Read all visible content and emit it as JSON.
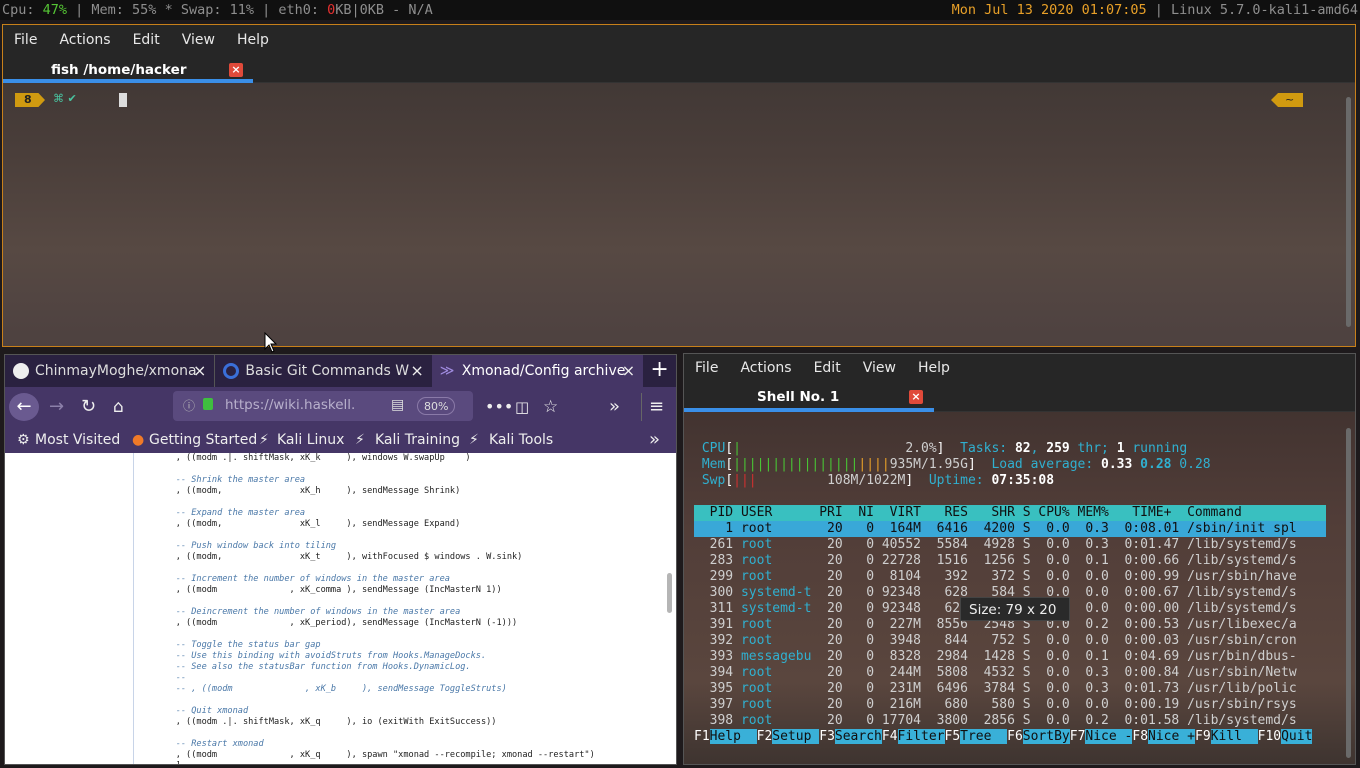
{
  "statusbar": {
    "cpu_label": "Cpu: ",
    "cpu_value": "47%",
    "mem": " | Mem: 55% * Swap: 11% | eth0: ",
    "eth_down": "0",
    "eth_rest": "KB|0KB - N/A",
    "datetime": "Mon Jul 13 2020 01:07:05",
    "kernel": " | Linux 5.7.0-kali1-amd64"
  },
  "term1": {
    "menu": [
      "File",
      "Actions",
      "Edit",
      "View",
      "Help"
    ],
    "tab_title": "fish /home/hacker",
    "close": "×",
    "prompt_num": "8",
    "prompt_symbols": "⌘ ✔",
    "prompt_right": "~"
  },
  "firefox": {
    "tabs": [
      {
        "label": "ChinmayMoghe/xmona",
        "close": "×"
      },
      {
        "label": "Basic Git Commands W",
        "close": "×"
      },
      {
        "label": "Xmonad/Config archive",
        "close": "×"
      }
    ],
    "new_tab": "+",
    "url": "https://wiki.haskell.",
    "zoom": "80%",
    "bookmarks": [
      "Most Visited",
      "Getting Started",
      "Kali Linux",
      "Kali Training",
      "Kali Tools"
    ],
    "code": [
      "    , ((modm .|. shiftMask, xK_k     ), windows W.swapUp    )",
      "",
      "    -- Shrink the master area",
      "    , ((modm,               xK_h     ), sendMessage Shrink)",
      "",
      "    -- Expand the master area",
      "    , ((modm,               xK_l     ), sendMessage Expand)",
      "",
      "    -- Push window back into tiling",
      "    , ((modm,               xK_t     ), withFocused $ windows . W.sink)",
      "",
      "    -- Increment the number of windows in the master area",
      "    , ((modm              , xK_comma ), sendMessage (IncMasterN 1))",
      "",
      "    -- Deincrement the number of windows in the master area",
      "    , ((modm              , xK_period), sendMessage (IncMasterN (-1)))",
      "",
      "    -- Toggle the status bar gap",
      "    -- Use this binding with avoidStruts from Hooks.ManageDocks.",
      "    -- See also the statusBar function from Hooks.DynamicLog.",
      "    --",
      "    -- , ((modm              , xK_b     ), sendMessage ToggleStruts)",
      "",
      "    -- Quit xmonad",
      "    , ((modm .|. shiftMask, xK_q     ), io (exitWith ExitSuccess))",
      "",
      "    -- Restart xmonad",
      "    , ((modm              , xK_q     ), spawn \"xmonad --recompile; xmonad --restart\")",
      "    ]"
    ]
  },
  "term2": {
    "menu": [
      "File",
      "Actions",
      "Edit",
      "View",
      "Help"
    ],
    "tab_title": "Shell No. 1",
    "close": "×",
    "size_popup": "Size: 79 x 20",
    "htop": {
      "cpu_label": "CPU",
      "cpu_bar": "|",
      "cpu_value": "2.0%",
      "mem_label": "Mem",
      "mem_bar_green": "||||||||||||||||",
      "mem_bar_orange": "||||",
      "mem_value": "935M/1.95G",
      "swp_label": "Swp",
      "swp_bar": "|||",
      "swp_value": "108M/1022M",
      "tasks_label": "Tasks: ",
      "tasks": "82",
      "thr": "259",
      "thr_label": " thr; ",
      "running": "1",
      "running_label": " running",
      "load_label": "Load average: ",
      "load1": "0.33",
      "load5": "0.28",
      "load15": "0.28",
      "uptime_label": "Uptime: ",
      "uptime": "07:35:08",
      "header": "  PID USER      PRI  NI  VIRT   RES   SHR S CPU% MEM%   TIME+  Command   ",
      "rows": [
        [
          "    1",
          " root      ",
          " 20   0  164M  6416  4200 S  0.0  0.3  0:08.01 /sbin/init spl"
        ],
        [
          "  261",
          " root      ",
          " 20   0 40552  5584  4928 S  0.0  0.3  0:01.47 /lib/systemd/s"
        ],
        [
          "  283",
          " root      ",
          " 20   0 22728  1516  1256 S  0.0  0.1  0:00.66 /lib/systemd/s"
        ],
        [
          "  299",
          " root      ",
          " 20   0  8104   392   372 S  0.0  0.0  0:00.99 /usr/sbin/have"
        ],
        [
          "  300",
          " systemd-t ",
          " 20   0 92348   628   584 S  0.0  0.0  0:00.67 /lib/systemd/s"
        ],
        [
          "  311",
          " systemd-t ",
          " 20   0 92348   628   584 S  0.0  0.0  0:00.00 /lib/systemd/s"
        ],
        [
          "  391",
          " root      ",
          " 20   0  227M  8556  2548 S  0.0  0.2  0:00.53 /usr/libexec/a"
        ],
        [
          "  392",
          " root      ",
          " 20   0  3948   844   752 S  0.0  0.0  0:00.03 /usr/sbin/cron"
        ],
        [
          "  393",
          " messagebu ",
          " 20   0  8328  2984  1428 S  0.0  0.1  0:04.69 /usr/bin/dbus-"
        ],
        [
          "  394",
          " root      ",
          " 20   0  244M  5808  4532 S  0.0  0.3  0:00.84 /usr/sbin/Netw"
        ],
        [
          "  395",
          " root      ",
          " 20   0  231M  6496  3784 S  0.0  0.3  0:01.73 /usr/lib/polic"
        ],
        [
          "  397",
          " root      ",
          " 20   0  216M   680   580 S  0.0  0.0  0:00.19 /usr/sbin/rsys"
        ],
        [
          "  398",
          " root      ",
          " 20   0 17704  3800  2856 S  0.0  0.2  0:01.58 /lib/systemd/s"
        ]
      ],
      "fkeys": [
        [
          "F1",
          "Help  "
        ],
        [
          "F2",
          "Setup "
        ],
        [
          "F3",
          "Search"
        ],
        [
          "F4",
          "Filter"
        ],
        [
          "F5",
          "Tree  "
        ],
        [
          "F6",
          "SortBy"
        ],
        [
          "F7",
          "Nice -"
        ],
        [
          "F8",
          "Nice +"
        ],
        [
          "F9",
          "Kill  "
        ],
        [
          "F10",
          "Quit"
        ]
      ]
    }
  }
}
